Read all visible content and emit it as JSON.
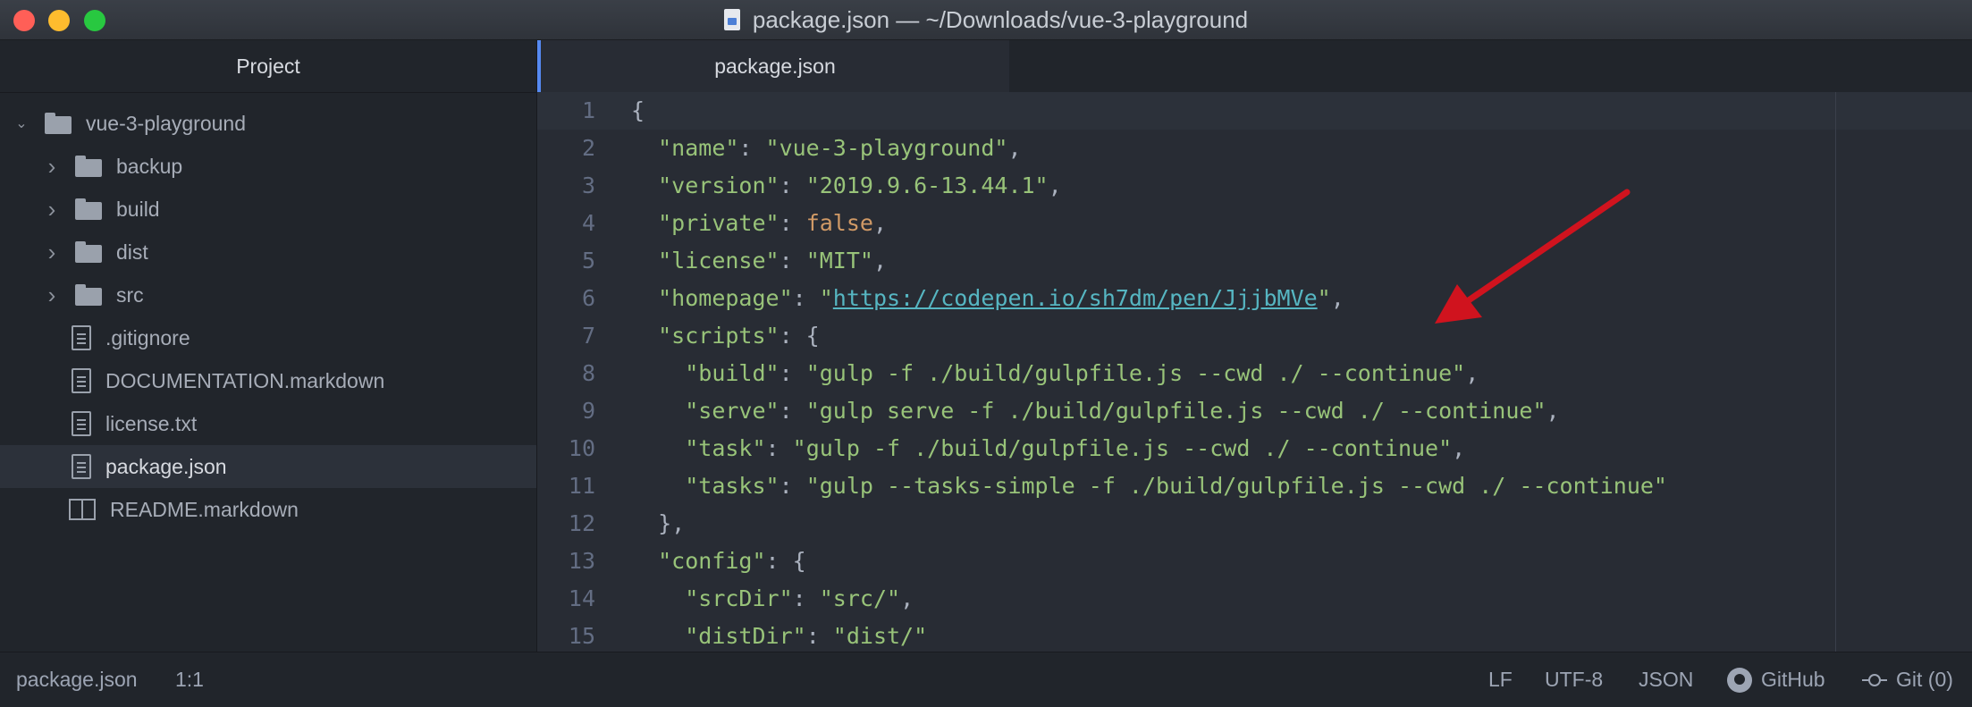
{
  "window": {
    "title": "package.json — ~/Downloads/vue-3-playground"
  },
  "sidebar": {
    "header": "Project",
    "root": "vue-3-playground",
    "items": [
      {
        "label": "backup",
        "type": "folder"
      },
      {
        "label": "build",
        "type": "folder"
      },
      {
        "label": "dist",
        "type": "folder"
      },
      {
        "label": "src",
        "type": "folder"
      },
      {
        "label": ".gitignore",
        "type": "file"
      },
      {
        "label": "DOCUMENTATION.markdown",
        "type": "file"
      },
      {
        "label": "license.txt",
        "type": "file"
      },
      {
        "label": "package.json",
        "type": "file",
        "selected": true
      },
      {
        "label": "README.markdown",
        "type": "book"
      }
    ]
  },
  "editor": {
    "tab": "package.json",
    "lines": [
      {
        "n": "1",
        "parts": [
          [
            "p",
            "{"
          ]
        ]
      },
      {
        "n": "2",
        "parts": [
          [
            "p",
            "  "
          ],
          [
            "k",
            "\"name\""
          ],
          [
            "p",
            ": "
          ],
          [
            "s",
            "\"vue-3-playground\""
          ],
          [
            "p",
            ","
          ]
        ]
      },
      {
        "n": "3",
        "parts": [
          [
            "p",
            "  "
          ],
          [
            "k",
            "\"version\""
          ],
          [
            "p",
            ": "
          ],
          [
            "s",
            "\"2019.9.6-13.44.1\""
          ],
          [
            "p",
            ","
          ]
        ]
      },
      {
        "n": "4",
        "parts": [
          [
            "p",
            "  "
          ],
          [
            "k",
            "\"private\""
          ],
          [
            "p",
            ": "
          ],
          [
            "b",
            "false"
          ],
          [
            "p",
            ","
          ]
        ]
      },
      {
        "n": "5",
        "parts": [
          [
            "p",
            "  "
          ],
          [
            "k",
            "\"license\""
          ],
          [
            "p",
            ": "
          ],
          [
            "s",
            "\"MIT\""
          ],
          [
            "p",
            ","
          ]
        ]
      },
      {
        "n": "6",
        "parts": [
          [
            "p",
            "  "
          ],
          [
            "k",
            "\"homepage\""
          ],
          [
            "p",
            ": "
          ],
          [
            "s",
            "\""
          ],
          [
            "u",
            "https://codepen.io/sh7dm/pen/JjjbMVe"
          ],
          [
            "s",
            "\""
          ],
          [
            "p",
            ","
          ]
        ]
      },
      {
        "n": "7",
        "parts": [
          [
            "p",
            "  "
          ],
          [
            "k",
            "\"scripts\""
          ],
          [
            "p",
            ": {"
          ]
        ]
      },
      {
        "n": "8",
        "parts": [
          [
            "p",
            "    "
          ],
          [
            "k",
            "\"build\""
          ],
          [
            "p",
            ": "
          ],
          [
            "s",
            "\"gulp -f ./build/gulpfile.js --cwd ./ --continue\""
          ],
          [
            "p",
            ","
          ]
        ]
      },
      {
        "n": "9",
        "parts": [
          [
            "p",
            "    "
          ],
          [
            "k",
            "\"serve\""
          ],
          [
            "p",
            ": "
          ],
          [
            "s",
            "\"gulp serve -f ./build/gulpfile.js --cwd ./ --continue\""
          ],
          [
            "p",
            ","
          ]
        ]
      },
      {
        "n": "10",
        "parts": [
          [
            "p",
            "    "
          ],
          [
            "k",
            "\"task\""
          ],
          [
            "p",
            ": "
          ],
          [
            "s",
            "\"gulp -f ./build/gulpfile.js --cwd ./ --continue\""
          ],
          [
            "p",
            ","
          ]
        ]
      },
      {
        "n": "11",
        "parts": [
          [
            "p",
            "    "
          ],
          [
            "k",
            "\"tasks\""
          ],
          [
            "p",
            ": "
          ],
          [
            "s",
            "\"gulp --tasks-simple -f ./build/gulpfile.js --cwd ./ --continue\""
          ]
        ]
      },
      {
        "n": "12",
        "parts": [
          [
            "p",
            "  },"
          ]
        ]
      },
      {
        "n": "13",
        "parts": [
          [
            "p",
            "  "
          ],
          [
            "k",
            "\"config\""
          ],
          [
            "p",
            ": {"
          ]
        ]
      },
      {
        "n": "14",
        "parts": [
          [
            "p",
            "    "
          ],
          [
            "k",
            "\"srcDir\""
          ],
          [
            "p",
            ": "
          ],
          [
            "s",
            "\"src/\""
          ],
          [
            "p",
            ","
          ]
        ]
      },
      {
        "n": "15",
        "parts": [
          [
            "p",
            "    "
          ],
          [
            "k",
            "\"distDir\""
          ],
          [
            "p",
            ": "
          ],
          [
            "s",
            "\"dist/\""
          ]
        ]
      }
    ]
  },
  "status": {
    "file": "package.json",
    "position": "1:1",
    "line_ending": "LF",
    "encoding": "UTF-8",
    "grammar": "JSON",
    "github": "GitHub",
    "git": "Git (0)"
  },
  "colors": {
    "accent": "#568af2",
    "annotation_arrow": "#d0131e"
  }
}
